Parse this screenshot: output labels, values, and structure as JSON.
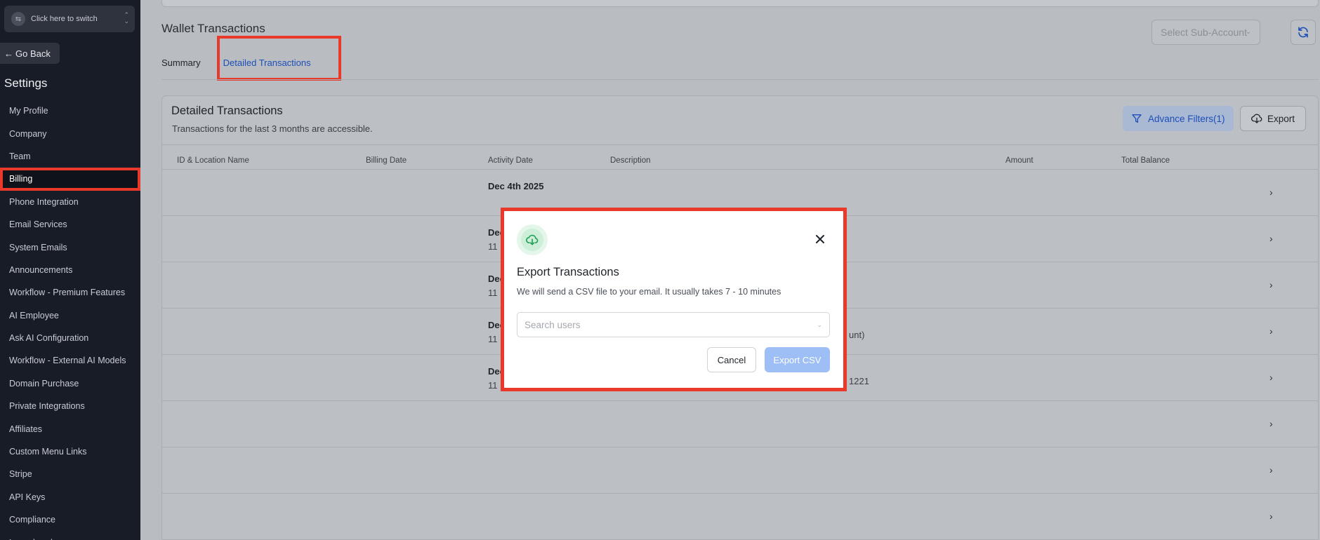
{
  "sidebar": {
    "switcher_label": "Click here to switch",
    "go_back": "Go Back",
    "settings_title": "Settings",
    "items": [
      {
        "label": "My Profile"
      },
      {
        "label": "Company"
      },
      {
        "label": "Team"
      },
      {
        "label": "Billing",
        "active": true
      },
      {
        "label": "Phone Integration"
      },
      {
        "label": "Email Services"
      },
      {
        "label": "System Emails"
      },
      {
        "label": "Announcements"
      },
      {
        "label": "Workflow - Premium Features"
      },
      {
        "label": "AI Employee"
      },
      {
        "label": "Ask AI Configuration"
      },
      {
        "label": "Workflow - External AI Models"
      },
      {
        "label": "Domain Purchase"
      },
      {
        "label": "Private Integrations"
      },
      {
        "label": "Affiliates"
      },
      {
        "label": "Custom Menu Links"
      },
      {
        "label": "Stripe"
      },
      {
        "label": "API Keys"
      },
      {
        "label": "Compliance"
      },
      {
        "label": "Launchpad"
      }
    ]
  },
  "header": {
    "title": "Wallet Transactions",
    "subaccount_placeholder": "Select Sub-Account"
  },
  "tabs": [
    {
      "label": "Summary",
      "active": false
    },
    {
      "label": "Detailed Transactions",
      "active": true
    }
  ],
  "card": {
    "title": "Detailed Transactions",
    "subtitle": "Transactions for the last 3 months are accessible.",
    "filter_button": "Advance Filters(1)",
    "export_button": "Export"
  },
  "table": {
    "columns": [
      "ID & Location Name",
      "Billing Date",
      "Activity Date",
      "Description",
      "Amount",
      "Total Balance"
    ],
    "rows": [
      {
        "activity_date": "Dec 4th 2025",
        "sub": "",
        "desc": ""
      },
      {
        "activity_date": "Dec",
        "sub": "11",
        "desc": ""
      },
      {
        "activity_date": "Dec",
        "sub": "11",
        "desc": ""
      },
      {
        "activity_date": "Dec",
        "sub": "11",
        "desc": "unt)"
      },
      {
        "activity_date": "Dec",
        "sub": "11",
        "desc": "1221"
      },
      {
        "activity_date": "",
        "sub": "",
        "desc": ""
      },
      {
        "activity_date": "",
        "sub": "",
        "desc": ""
      },
      {
        "activity_date": "",
        "sub": "",
        "desc": ""
      }
    ]
  },
  "modal": {
    "icon": "cloud-download-icon",
    "title": "Export Transactions",
    "description": "We will send a CSV file to your email. It usually takes 7 - 10 minutes",
    "search_placeholder": "Search users",
    "cancel": "Cancel",
    "export_csv": "Export CSV"
  },
  "colors": {
    "accent": "#1d4fb8",
    "highlight": "#e8392a",
    "export_disabled": "#9ebff5",
    "success_icon": "#22a055"
  }
}
